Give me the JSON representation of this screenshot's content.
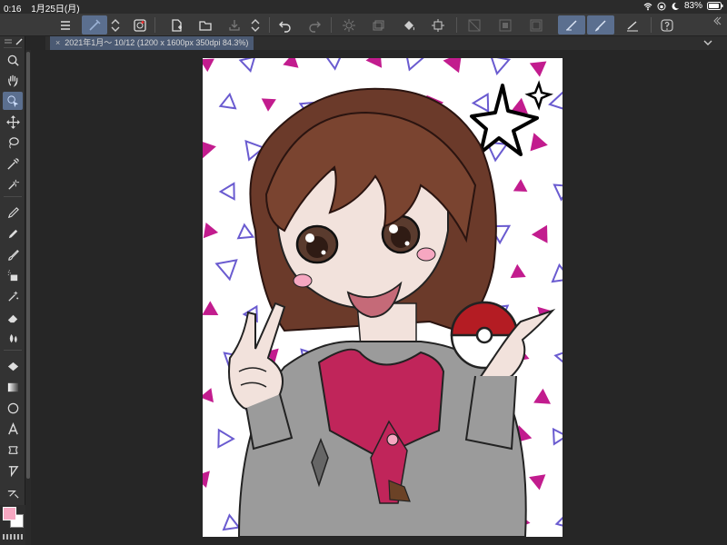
{
  "status_bar": {
    "time": "0:16",
    "date": "1月25日(月)",
    "battery": "83%",
    "icons": [
      "wifi-icon",
      "orientation-lock-icon",
      "moon-icon",
      "battery-icon"
    ]
  },
  "toolbar": {
    "items": [
      "menu-icon",
      "pen-pressure-icon",
      "stepper-icon",
      "companion-mode-icon",
      "new-file-icon",
      "open-file-icon",
      "save-icon",
      "stepper-icon",
      "undo-icon",
      "redo-icon",
      "clear-icon",
      "copy-layer-icon",
      "fill-icon",
      "transform-icon",
      "clip-icon",
      "invert-icon",
      "border-icon",
      "snap-ruler-icon",
      "snap-brush-icon",
      "snap-special-icon",
      "help-icon"
    ]
  },
  "document_tab": {
    "title": "2021年1月～ 10/12 (1200 x 1600px 350dpi 84.3%)"
  },
  "tools": [
    "zoom-icon",
    "hand-icon",
    "select-layer-icon",
    "move-icon",
    "lasso-icon",
    "eyedropper-icon",
    "auto-select-icon",
    "pen-icon",
    "pencil-icon",
    "brush-icon",
    "airbrush-icon",
    "decoration-icon",
    "eraser-icon",
    "blend-icon",
    "fill-bucket-icon",
    "gradient-icon",
    "figure-icon",
    "text-icon",
    "frame-icon",
    "balloon-icon",
    "correction-line-icon"
  ],
  "colors": {
    "foreground": "#f6a7c1",
    "background": "#ffffff",
    "accent": "#5b6f8f",
    "triangle_pattern": "#c21c8e"
  },
  "canvas": {
    "artwork": "anime girl with bob haircut holding a poké ball"
  }
}
